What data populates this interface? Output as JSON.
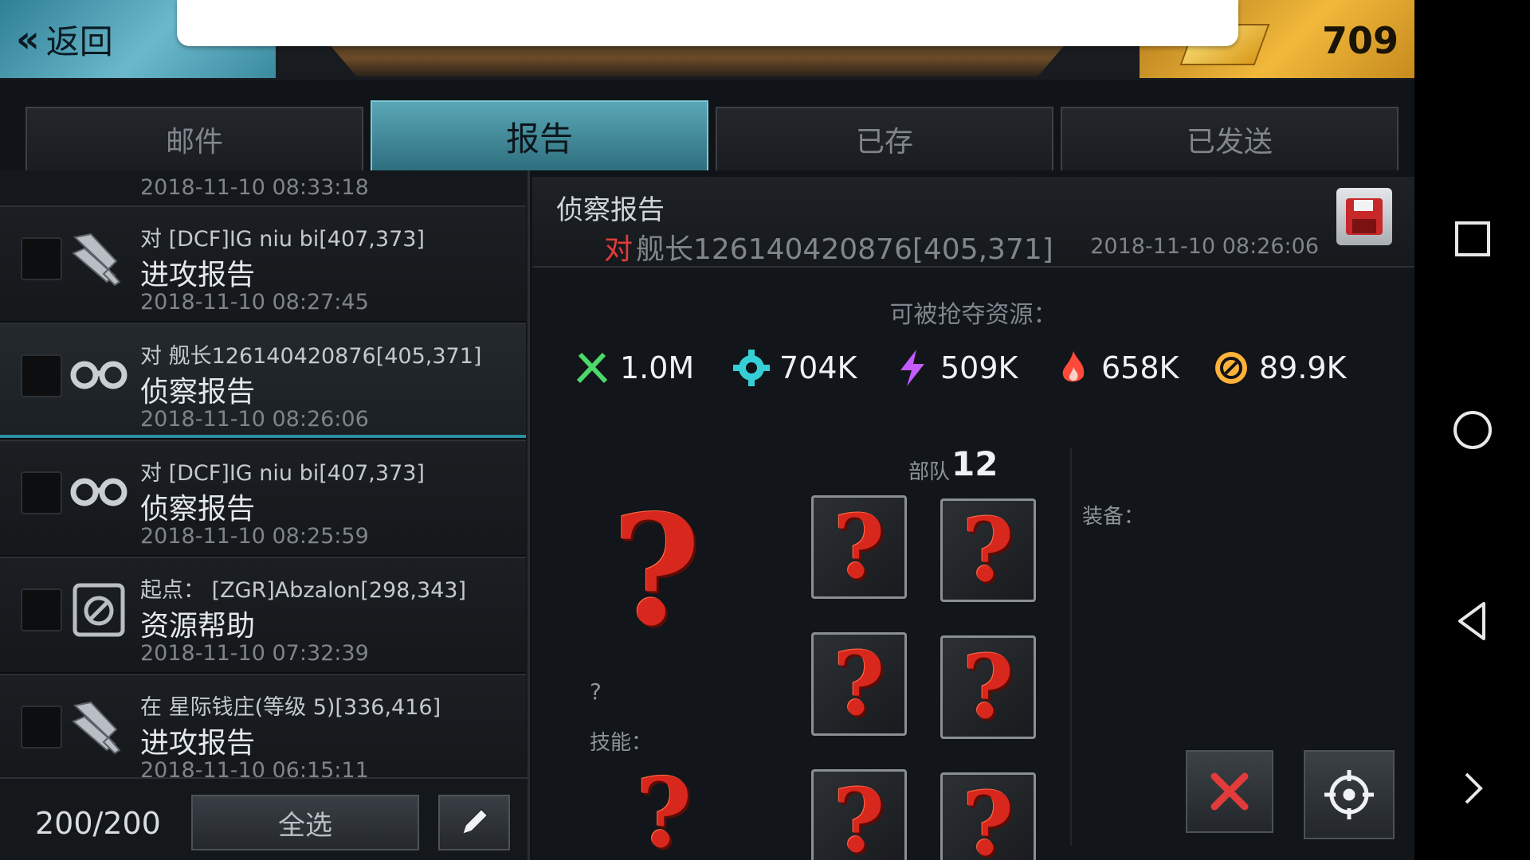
{
  "topbar": {
    "back_label": "返回",
    "gold_count": "709"
  },
  "tabs": [
    {
      "label": "邮件",
      "active": false
    },
    {
      "label": "报告",
      "active": true
    },
    {
      "label": "已存",
      "active": false
    },
    {
      "label": "已发送",
      "active": false
    }
  ],
  "list": {
    "top_partial_date": "2018-11-10 08:33:18",
    "rows": [
      {
        "target": "对 [DCF]IG niu bi[407,373]",
        "title": "进攻报告",
        "date": "2018-11-10 08:27:45",
        "icon": "attack-icon"
      },
      {
        "target": "对 舰长126140420876[405,371]",
        "title": "侦察报告",
        "date": "2018-11-10 08:26:06",
        "icon": "scout-icon"
      },
      {
        "target": "对 [DCF]IG niu bi[407,373]",
        "title": "侦察报告",
        "date": "2018-11-10 08:25:59",
        "icon": "scout-icon"
      },
      {
        "target": "起点： [ZGR]Abzalon[298,343]",
        "title": "资源帮助",
        "date": "2018-11-10 07:32:39",
        "icon": "resource-help-icon"
      },
      {
        "target": "在 星际钱庄(等级 5)[336,416]",
        "title": "进攻报告",
        "date": "2018-11-10 06:15:11",
        "icon": "attack-icon"
      }
    ],
    "count": "200/200",
    "select_all_label": "全选"
  },
  "report": {
    "heading": "侦察报告",
    "to_label": "对",
    "target": "舰长126140420876[405,371]",
    "datetime": "2018-11-10 08:26:06",
    "loot_title": "可被抢夺资源：",
    "resources": [
      {
        "icon": "food-icon",
        "value": "1.0M",
        "color": "#4cd96a"
      },
      {
        "icon": "gear-icon",
        "value": "704K",
        "color": "#35d0d6"
      },
      {
        "icon": "energy-icon",
        "value": "509K",
        "color": "#c35bff"
      },
      {
        "icon": "fire-icon",
        "value": "658K",
        "color": "#ff4a3a"
      },
      {
        "icon": "coin-icon",
        "value": "89.9K",
        "color": "#ffb23a"
      }
    ],
    "troops_label": "部队",
    "troops_count": "12",
    "equip_label": "装备：",
    "hero_unknown": "?",
    "skill_label": "技能：",
    "unknown_glyph": "?"
  },
  "colors": {
    "accent_teal": "#2c8ea2",
    "gold": "#f1b83b",
    "danger": "#e23b3b"
  }
}
